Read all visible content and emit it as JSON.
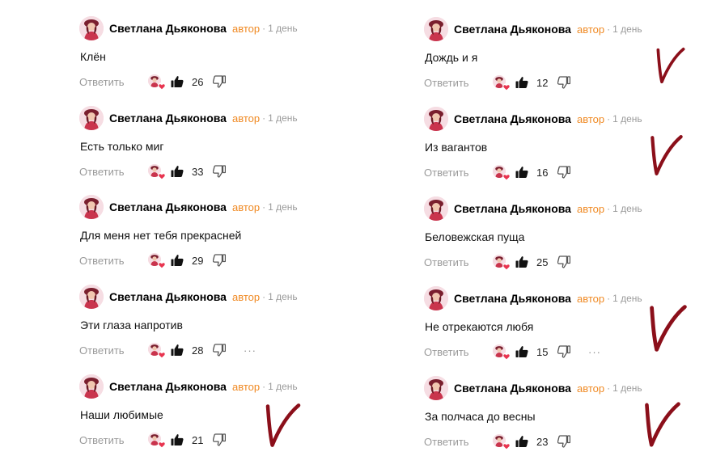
{
  "left_column": [
    {
      "author": "Светлана Дьяконова",
      "badge": "автор",
      "separator": "·",
      "time": "1 день",
      "text": "Клён",
      "reply_label": "Ответить",
      "likes": "26",
      "has_more": false,
      "checkmark": false
    },
    {
      "author": "Светлана Дьяконова",
      "badge": "автор",
      "separator": "·",
      "time": "1 день",
      "text": "Есть только миг",
      "reply_label": "Ответить",
      "likes": "33",
      "has_more": false,
      "checkmark": false
    },
    {
      "author": "Светлана Дьяконова",
      "badge": "автор",
      "separator": "·",
      "time": "1 день",
      "text": "Для меня нет тебя прекрасней",
      "reply_label": "Ответить",
      "likes": "29",
      "has_more": false,
      "checkmark": false
    },
    {
      "author": "Светлана Дьяконова",
      "badge": "автор",
      "separator": "·",
      "time": "1 день",
      "text": "Эти глаза напротив",
      "reply_label": "Ответить",
      "likes": "28",
      "has_more": true,
      "more_label": "···",
      "checkmark": false
    },
    {
      "author": "Светлана Дьяконова",
      "badge": "автор",
      "separator": "·",
      "time": "1 день",
      "text": "Наши любимые",
      "reply_label": "Ответить",
      "likes": "21",
      "has_more": false,
      "checkmark": true
    }
  ],
  "right_column": [
    {
      "author": "Светлана Дьяконова",
      "badge": "автор",
      "separator": "·",
      "time": "1 день",
      "text": "Дождь и я",
      "reply_label": "Ответить",
      "likes": "12",
      "has_more": false,
      "checkmark": true
    },
    {
      "author": "Светлана Дьяконова",
      "badge": "автор",
      "separator": "·",
      "time": "1 день",
      "text": "Из вагантов",
      "reply_label": "Ответить",
      "likes": "16",
      "has_more": false,
      "checkmark": true
    },
    {
      "author": "Светлана Дьяконова",
      "badge": "автор",
      "separator": "·",
      "time": "1 день",
      "text": "Беловежская пуща",
      "reply_label": "Ответить",
      "likes": "25",
      "has_more": false,
      "checkmark": false
    },
    {
      "author": "Светлана Дьяконова",
      "badge": "автор",
      "separator": "·",
      "time": "1 день",
      "text": "Не отрекаются любя",
      "reply_label": "Ответить",
      "likes": "15",
      "has_more": true,
      "more_label": "···",
      "checkmark": true
    },
    {
      "author": "Светлана Дьяконова",
      "badge": "автор",
      "separator": "·",
      "time": "1 день",
      "text": "За полчаса до весны",
      "reply_label": "Ответить",
      "likes": "23",
      "has_more": false,
      "checkmark": true
    }
  ],
  "colors": {
    "badge": "#f08a24",
    "meta": "#9a9a9a",
    "checkmark": "#8b0f1a",
    "heart": "#e8344f"
  },
  "icons": {
    "avatar": "avatar-icon",
    "reaction": "reaction-heart-icon",
    "like": "thumbs-up-icon",
    "dislike": "thumbs-down-icon",
    "more": "more-options-icon",
    "checkmark": "handwritten-checkmark-icon"
  }
}
